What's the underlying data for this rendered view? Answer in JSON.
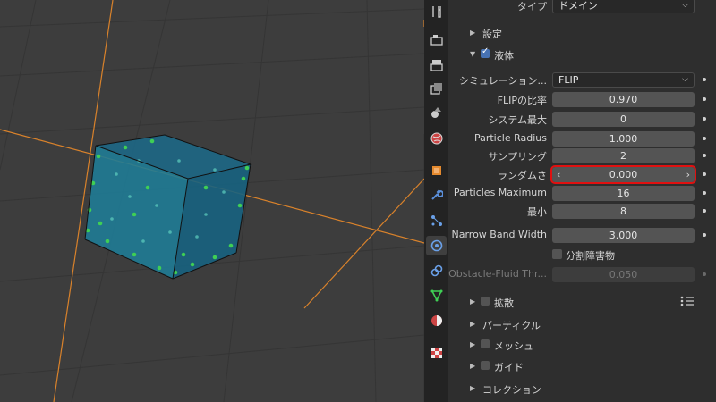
{
  "top_row": {
    "label": "タイプ",
    "value": "ドメイン"
  },
  "panels": {
    "settings": "設定",
    "liquid": "液体",
    "diffusion": "拡散",
    "particles": "パーティクル",
    "mesh": "メッシュ",
    "guide": "ガイド",
    "collection": "コレクション"
  },
  "sim_method": {
    "label": "シミュレーション...",
    "value": "FLIP"
  },
  "fields": {
    "flip_ratio": {
      "label": "FLIPの比率",
      "value": "0.970"
    },
    "system_max": {
      "label": "システム最大",
      "value": "0"
    },
    "particle_radius": {
      "label": "Particle Radius",
      "value": "1.000"
    },
    "sampling": {
      "label": "サンプリング",
      "value": "2"
    },
    "randomness": {
      "label": "ランダムさ",
      "value": "0.000"
    },
    "particles_maximum": {
      "label": "Particles Maximum",
      "value": "16"
    },
    "minimum": {
      "label": "最小",
      "value": "8"
    },
    "narrow_band": {
      "label": "Narrow Band Width",
      "value": "3.000"
    },
    "obstacle": {
      "label": "Obstacle-Fluid Thr...",
      "value": "0.050"
    }
  },
  "fractional_obstacles": "分割障害物",
  "colors": {
    "highlight": "#e01010",
    "active_tab": "#4772b3",
    "grid_orange": "#d9822b"
  },
  "tab_icons": [
    "tool-icon",
    "render-icon",
    "output-icon",
    "view-layer-icon",
    "scene-icon",
    "world-icon",
    "object-icon",
    "modifier-icon",
    "particles-icon",
    "physics-icon",
    "constraints-icon",
    "data-icon",
    "material-icon",
    "texture-icon"
  ]
}
